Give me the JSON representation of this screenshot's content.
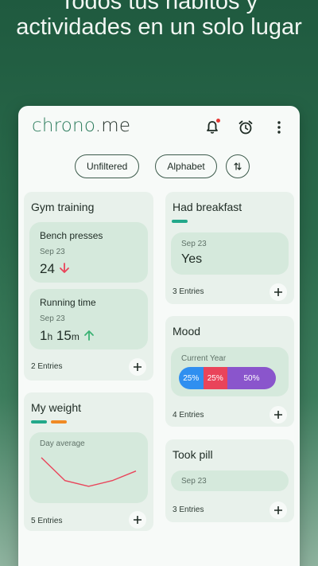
{
  "headline": {
    "line1": "Todos tus hábitos y",
    "line2": "actividades en un solo lugar"
  },
  "app": {
    "brand_part1": "chrono",
    "brand_dot": ".",
    "brand_part2": "me",
    "icons": [
      "bell-icon",
      "alarm-clock-icon",
      "more-vert-icon"
    ],
    "accent_color": "#2e7d5e"
  },
  "filters": {
    "unfiltered": "Unfiltered",
    "alphabet": "Alphabet",
    "sort_icon": "sort-arrows-icon"
  },
  "gym": {
    "title": "Gym training",
    "bench": {
      "title": "Bench presses",
      "date": "Sep 23",
      "value": "24",
      "trend": "down"
    },
    "running": {
      "title": "Running time",
      "date": "Sep 23",
      "hours": "1",
      "h_unit": "h",
      "minutes": "15",
      "m_unit": "m",
      "trend": "up"
    },
    "entries": "2 Entries"
  },
  "breakfast": {
    "title": "Had breakfast",
    "bar_color": "#22a88a",
    "date": "Sep 23",
    "value": "Yes",
    "entries": "3 Entries"
  },
  "mood": {
    "title": "Mood",
    "label": "Current Year",
    "segments": [
      {
        "label": "25%",
        "percent": 25,
        "color": "#2f8ff0"
      },
      {
        "label": "25%",
        "percent": 25,
        "color": "#e9445a"
      },
      {
        "label": "50%",
        "percent": 50,
        "color": "#8a55cc"
      }
    ],
    "entries": "4 Entries"
  },
  "weight": {
    "title": "My weight",
    "bar_colors": [
      "#22a88a",
      "#f08a24"
    ],
    "label": "Day average",
    "entries": "5 Entries",
    "chart_data": {
      "type": "line",
      "values": [
        10,
        4,
        2.5,
        4,
        6.5
      ],
      "color": "#e9445a"
    }
  },
  "pill": {
    "title": "Took pill",
    "date": "Sep 23",
    "entries": "3 Entries"
  },
  "colors": {
    "down_arrow": "#e9445a",
    "up_arrow": "#3bb274"
  }
}
